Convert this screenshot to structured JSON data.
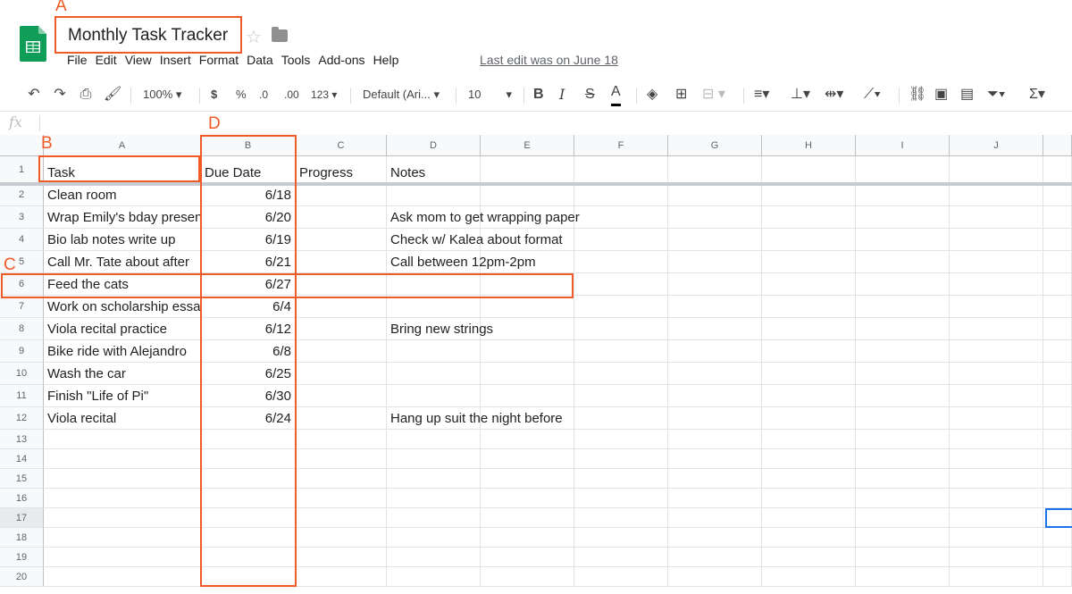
{
  "app": {
    "title": "Monthly Task Tracker",
    "logo_icon": "sheets-logo-icon",
    "last_edit": "Last edit was on June 18"
  },
  "menu": [
    "File",
    "Edit",
    "View",
    "Insert",
    "Format",
    "Data",
    "Tools",
    "Add-ons",
    "Help"
  ],
  "toolbar": {
    "undo_icon": "undo-icon",
    "redo_icon": "redo-icon",
    "print_icon": "print-icon",
    "paint_format_icon": "paint-format-icon",
    "zoom": "100%",
    "currency": "$",
    "percent": "%",
    "decrease_decimal": ".0",
    "increase_decimal": ".00",
    "more_formats": "123",
    "font": "Default (Ari...",
    "font_size": "10",
    "bold": "B",
    "italic": "I",
    "strikethrough": "S",
    "text_color": "A"
  },
  "formula_bar": {
    "label": "fx",
    "value": ""
  },
  "columns": [
    "A",
    "B",
    "C",
    "D",
    "E",
    "F",
    "G",
    "H",
    "I",
    "J"
  ],
  "rows": [
    "1",
    "2",
    "3",
    "4",
    "5",
    "6",
    "7",
    "8",
    "9",
    "10",
    "11",
    "12",
    "13",
    "14",
    "15",
    "16",
    "17",
    "18",
    "19",
    "20"
  ],
  "sheet": {
    "headers": {
      "task": "Task",
      "due": "Due Date",
      "progress": "Progress",
      "notes": "Notes"
    },
    "data": [
      {
        "task": "Clean room",
        "due": "6/18",
        "notes": ""
      },
      {
        "task": "Wrap Emily's bday present",
        "due": "6/20",
        "notes": "Ask mom to get wrapping paper"
      },
      {
        "task": "Bio lab notes write up",
        "due": "6/19",
        "notes": "Check w/ Kalea about format"
      },
      {
        "task": "Call Mr. Tate about after",
        "due": "6/21",
        "notes": "Call between 12pm-2pm"
      },
      {
        "task": "Feed the cats",
        "due": "6/27",
        "notes": ""
      },
      {
        "task": "Work on scholarship essay",
        "due": "6/4",
        "notes": ""
      },
      {
        "task": "Viola recital practice",
        "due": "6/12",
        "notes": "Bring new strings"
      },
      {
        "task": "Bike ride with Alejandro",
        "due": "6/8",
        "notes": ""
      },
      {
        "task": "Wash the car",
        "due": "6/25",
        "notes": ""
      },
      {
        "task": "Finish \"Life of Pi\"",
        "due": "6/30",
        "notes": ""
      },
      {
        "task": "Viola recital",
        "due": "6/24",
        "notes": "Hang up suit the night before"
      }
    ]
  },
  "annotations": {
    "a": "A",
    "b": "B",
    "c": "C",
    "d": "D"
  },
  "colors": {
    "annotation": "#f05a28",
    "selection": "#1a73e8",
    "sheets_green": "#0f9d58"
  }
}
